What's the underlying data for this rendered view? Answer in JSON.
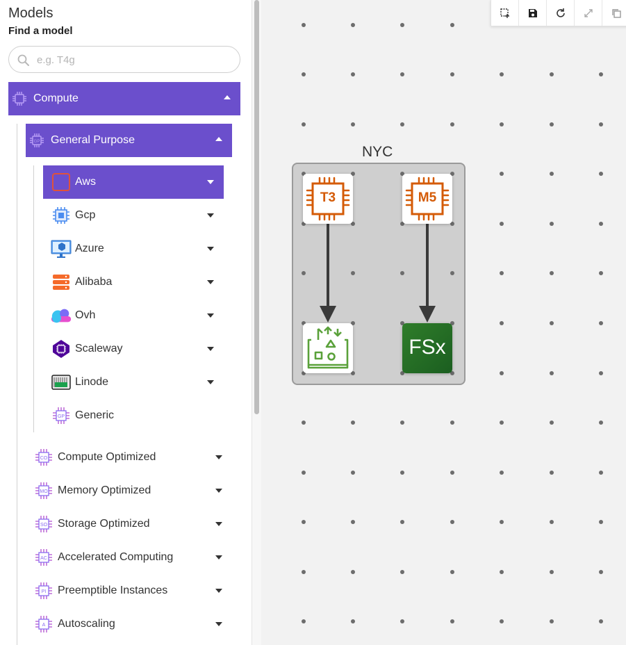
{
  "sidebar": {
    "title": "Models",
    "subtitle": "Find a model",
    "search_placeholder": "e.g. T4g",
    "compute": {
      "label": "Compute"
    },
    "general_purpose": {
      "label": "General Purpose"
    },
    "providers": [
      {
        "label": "Aws"
      },
      {
        "label": "Gcp"
      },
      {
        "label": "Azure"
      },
      {
        "label": "Alibaba"
      },
      {
        "label": "Ovh"
      },
      {
        "label": "Scaleway"
      },
      {
        "label": "Linode"
      },
      {
        "label": "Generic",
        "badge": "GP"
      }
    ],
    "categories": [
      {
        "label": "Compute Optimized",
        "badge": "CO"
      },
      {
        "label": "Memory Optimized",
        "badge": "MO"
      },
      {
        "label": "Storage Optimized",
        "badge": "SO"
      },
      {
        "label": "Accelerated Computing",
        "badge": "AC"
      },
      {
        "label": "Preemptible Instances",
        "badge": "PI"
      },
      {
        "label": "Autoscaling",
        "badge": "A"
      }
    ]
  },
  "canvas": {
    "group_label": "NYC",
    "nodes": {
      "t3": {
        "label": "T3"
      },
      "m5": {
        "label": "M5"
      },
      "fsx": {
        "label": "FSx"
      }
    }
  },
  "colors": {
    "accent": "#6b4fcc",
    "aws_orange": "#d45b07",
    "green": "#3f8624"
  },
  "icons": {
    "toolbar": [
      "select-area-icon",
      "save-icon",
      "refresh-icon",
      "expand-icon",
      "copy-icon"
    ]
  }
}
